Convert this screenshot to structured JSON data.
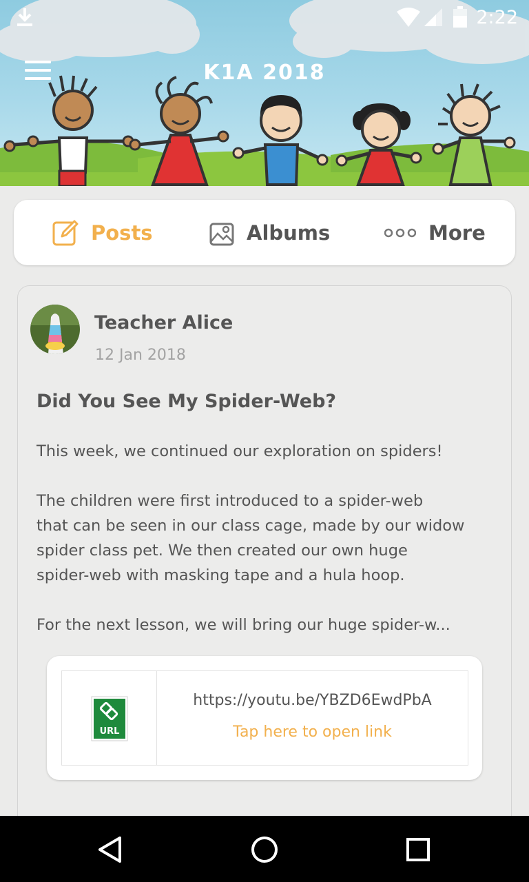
{
  "status_bar": {
    "time": "2:22",
    "icons": [
      "download-icon",
      "wifi-icon",
      "signal-icon",
      "battery-icon"
    ]
  },
  "app_bar": {
    "title": "K1A 2018",
    "menu_icon": "menu-icon"
  },
  "tabs": [
    {
      "label": "Posts",
      "icon": "edit-icon",
      "active": true
    },
    {
      "label": "Albums",
      "icon": "image-icon",
      "active": false
    },
    {
      "label": "More",
      "icon": "more-horizontal-icon",
      "active": false
    }
  ],
  "post": {
    "author": "Teacher Alice",
    "date": "12 Jan 2018",
    "title": "Did You See My Spider-Web?",
    "paragraphs": [
      "This week, we continued our exploration on spiders!",
      "The children were first introduced to a spider-web\nthat can be seen in our class cage, made by our widow\nspider class pet. We then created our own huge\nspider-web with masking tape and a hula hoop.",
      "For the next lesson, we will bring our huge spider-w..."
    ],
    "link": {
      "url": "https://youtu.be/YBZD6EwdPbA",
      "cta": "Tap here to open link",
      "icon_text": "URL"
    }
  },
  "colors": {
    "accent": "#f2b04d",
    "text": "#555555",
    "muted": "#a3a3a3",
    "background": "#ebebea"
  },
  "nav_bar": {
    "icons": [
      "back-icon",
      "home-icon",
      "recents-icon"
    ]
  }
}
